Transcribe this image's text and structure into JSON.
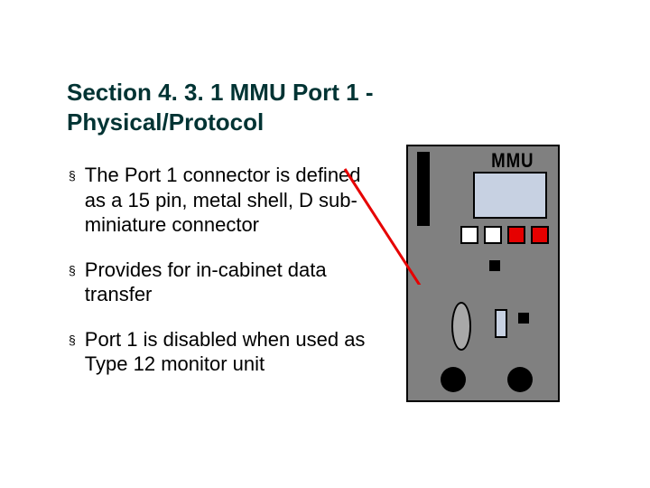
{
  "title": "Section 4. 3. 1 MMU Port 1 - Physical/Protocol",
  "bullets": [
    "The Port 1 connector is defined as a 15 pin, metal shell, D sub-miniature connector",
    "Provides for in-cabinet data transfer",
    "Port 1 is disabled when used as Type 12 monitor unit"
  ],
  "mmu": {
    "label": "MMU"
  }
}
